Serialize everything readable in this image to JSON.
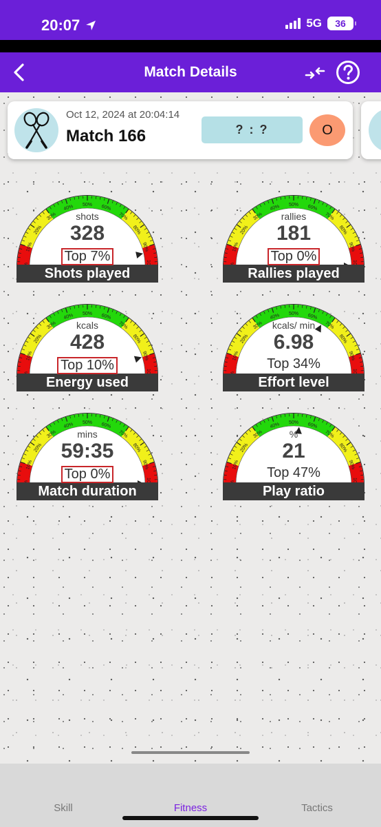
{
  "status": {
    "time": "20:07",
    "network": "5G",
    "battery": "36"
  },
  "nav": {
    "title": "Match Details"
  },
  "match": {
    "date": "Oct 12, 2024 at 20:04:14",
    "name": "Match 166",
    "score": "? : ?",
    "result": "O"
  },
  "gauge_ticks": [
    "0%",
    "10%",
    "20%",
    "30%",
    "40%",
    "50%",
    "60%",
    "70%",
    "80%",
    "90%",
    "100%"
  ],
  "gauges": [
    {
      "unit": "shots",
      "value": "328",
      "rank": "Top 7%",
      "rank_boxed": true,
      "label": "Shots played",
      "needle_percent": 93
    },
    {
      "unit": "rallies",
      "value": "181",
      "rank": "Top 0%",
      "rank_boxed": true,
      "label": "Rallies played",
      "needle_percent": 100
    },
    {
      "unit": "kcals",
      "value": "428",
      "rank": "Top 10%",
      "rank_boxed": true,
      "label": "Energy used",
      "needle_percent": 90
    },
    {
      "unit": "kcals/ min",
      "value": "6.98",
      "rank": "Top 34%",
      "rank_boxed": false,
      "label": "Effort level",
      "needle_percent": 66
    },
    {
      "unit": "mins",
      "value": "59:35",
      "rank": "Top 0%",
      "rank_boxed": true,
      "label": "Match duration",
      "needle_percent": 100
    },
    {
      "unit": "%",
      "value": "21",
      "rank": "Top 47%",
      "rank_boxed": false,
      "label": "Play ratio",
      "needle_percent": 53
    }
  ],
  "tabs": [
    "Skill",
    "Fitness",
    "Tactics"
  ],
  "colors": {
    "brand": "#6b1fd8",
    "active_tab": "#7b22e0",
    "green": "#23d80b",
    "yellow": "#f1f01a",
    "red": "#e80d0d",
    "label_band": "#3a3a3a",
    "rank_box": "#c8262a"
  }
}
